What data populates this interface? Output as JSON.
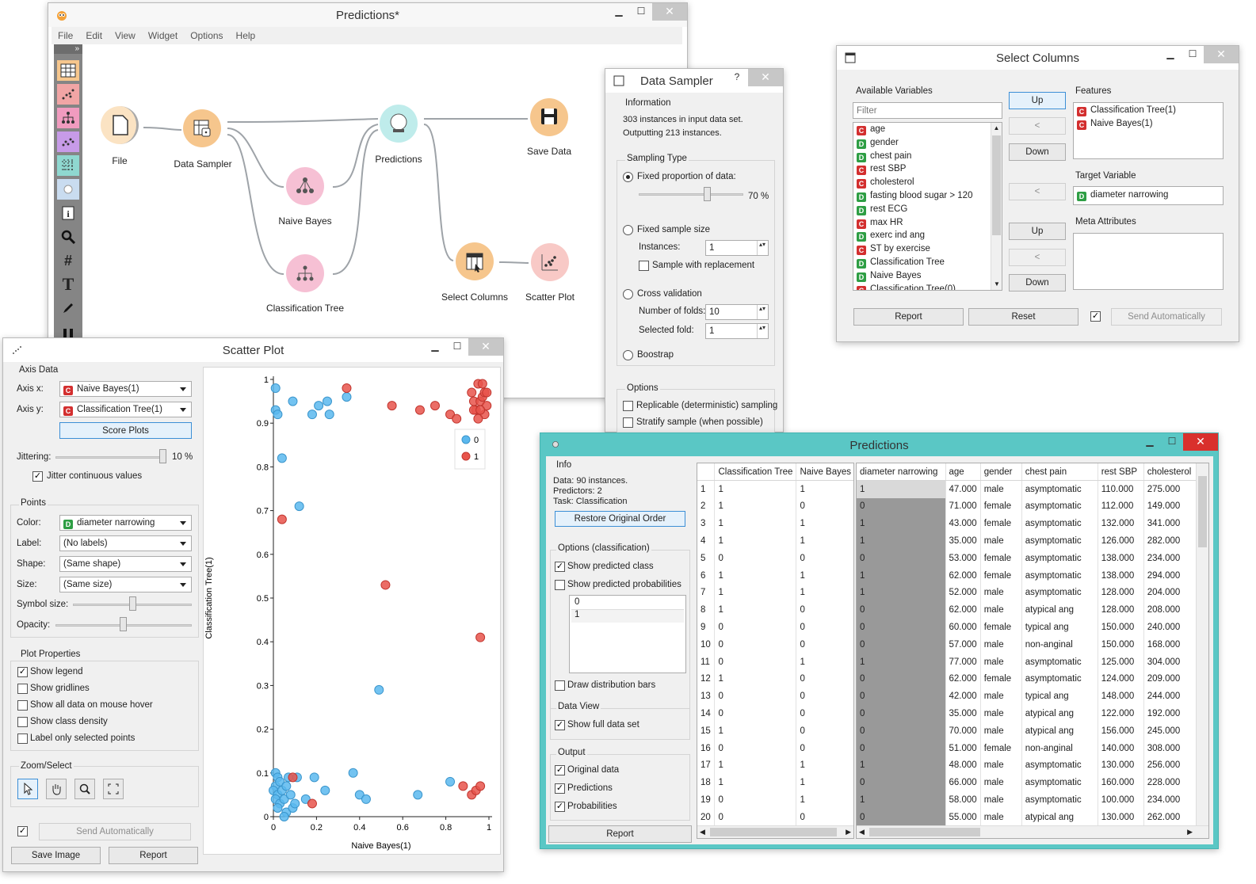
{
  "main": {
    "title": "Predictions*",
    "menu": [
      "File",
      "Edit",
      "View",
      "Widget",
      "Options",
      "Help"
    ],
    "nodes": {
      "file": "File",
      "data_sampler": "Data Sampler",
      "predictions": "Predictions",
      "save_data": "Save Data",
      "naive_bayes": "Naive Bayes",
      "classification_tree": "Classification Tree",
      "select_columns": "Select Columns",
      "scatter_plot": "Scatter Plot"
    },
    "toolbar_glyphs": {
      "more": "»",
      "hash": "#",
      "text": "T"
    }
  },
  "sampler": {
    "title": "Data Sampler",
    "help": "?",
    "information_label": "Information",
    "info1": "303 instances in input data set.",
    "info2": "Outputting 213 instances.",
    "sampling_type_label": "Sampling Type",
    "fixed_proportion": "Fixed proportion of data:",
    "proportion_pct": 70,
    "proportion_value": "70 %",
    "fixed_sample_size": "Fixed sample size",
    "instances_label": "Instances:",
    "instances_value": "1",
    "with_replacement": "Sample with replacement",
    "cross_validation": "Cross validation",
    "folds_label": "Number of folds:",
    "folds_value": "10",
    "selected_fold_label": "Selected fold:",
    "selected_fold_value": "1",
    "bootstrap": "Boostrap",
    "options_label": "Options",
    "replicable": "Replicable (deterministic) sampling",
    "stratify": "Stratify sample (when possible)"
  },
  "select_columns": {
    "title": "Select Columns",
    "available_label": "Available Variables",
    "filter_placeholder": "Filter",
    "available": [
      {
        "t": "C",
        "n": "age"
      },
      {
        "t": "D",
        "n": "gender"
      },
      {
        "t": "D",
        "n": "chest pain"
      },
      {
        "t": "C",
        "n": "rest SBP"
      },
      {
        "t": "C",
        "n": "cholesterol"
      },
      {
        "t": "D",
        "n": "fasting blood sugar > 120"
      },
      {
        "t": "D",
        "n": "rest ECG"
      },
      {
        "t": "C",
        "n": "max HR"
      },
      {
        "t": "D",
        "n": "exerc ind ang"
      },
      {
        "t": "C",
        "n": "ST by exercise"
      },
      {
        "t": "D",
        "n": "Classification Tree"
      },
      {
        "t": "D",
        "n": "Naive Bayes"
      },
      {
        "t": "C",
        "n": "Classification Tree(0)"
      }
    ],
    "up": "Up",
    "down": "Down",
    "arrow": "<",
    "features_label": "Features",
    "features": [
      {
        "t": "C",
        "n": "Classification Tree(1)"
      },
      {
        "t": "C",
        "n": "Naive Bayes(1)"
      }
    ],
    "target_label": "Target Variable",
    "target": {
      "t": "D",
      "n": "diameter narrowing"
    },
    "meta_label": "Meta Attributes",
    "report": "Report",
    "reset": "Reset",
    "send_auto": "Send Automatically",
    "check": "✓"
  },
  "scatter": {
    "title": "Scatter Plot",
    "axis_data_label": "Axis Data",
    "axis_x_label": "Axis x:",
    "axis_x": "Naive Bayes(1)",
    "axis_y_label": "Axis y:",
    "axis_y": "Classification Tree(1)",
    "score_plots": "Score Plots",
    "jittering_label": "Jittering:",
    "jittering_value": "10 %",
    "jittering_pct": 100,
    "jitter_cont": "Jitter continuous values",
    "points_label": "Points",
    "color_label": "Color:",
    "color_value": "diameter narrowing",
    "label_label": "Label:",
    "label_value": "(No labels)",
    "shape_label": "Shape:",
    "shape_value": "(Same shape)",
    "size_label": "Size:",
    "size_value": "(Same size)",
    "symbol_size_label": "Symbol size:",
    "symbol_size_pct": 50,
    "opacity_label": "Opacity:",
    "opacity_pct": 45,
    "plot_props_label": "Plot Properties",
    "show_legend": "Show legend",
    "show_gridlines": "Show gridlines",
    "show_all_data": "Show all data on mouse hover",
    "show_density": "Show class density",
    "label_selected": "Label only selected points",
    "zoom_label": "Zoom/Select",
    "send_auto": "Send Automatically",
    "save_image": "Save Image",
    "report": "Report",
    "check": "✓"
  },
  "predictions": {
    "title": "Predictions",
    "info_label": "Info",
    "info1": "Data: 90 instances.",
    "info2": "Predictors: 2",
    "info3": "Task: Classification",
    "restore": "Restore Original Order",
    "options_label": "Options (classification)",
    "show_class": "Show predicted class",
    "show_probs": "Show predicted probabilities",
    "classes": [
      "0",
      "1"
    ],
    "draw_bars": "Draw distribution bars",
    "data_view_label": "Data View",
    "show_full": "Show full data set",
    "output_label": "Output",
    "original_data": "Original data",
    "predictions_out": "Predictions",
    "probabilities": "Probabilities",
    "report": "Report",
    "check": "✓",
    "pred_headers": [
      "Classification Tree",
      "Naive Bayes"
    ],
    "data_headers": [
      "diameter narrowing",
      "age",
      "gender",
      "chest pain",
      "rest SBP",
      "cholesterol"
    ],
    "rows": [
      [
        "1",
        "1",
        "1",
        "1",
        "47.000",
        "male",
        "asymptomatic",
        "110.000",
        "275.000"
      ],
      [
        "2",
        "1",
        "0",
        "0",
        "71.000",
        "female",
        "asymptomatic",
        "112.000",
        "149.000"
      ],
      [
        "3",
        "1",
        "1",
        "1",
        "43.000",
        "female",
        "asymptomatic",
        "132.000",
        "341.000"
      ],
      [
        "4",
        "1",
        "1",
        "1",
        "35.000",
        "male",
        "asymptomatic",
        "126.000",
        "282.000"
      ],
      [
        "5",
        "0",
        "0",
        "0",
        "53.000",
        "female",
        "asymptomatic",
        "138.000",
        "234.000"
      ],
      [
        "6",
        "1",
        "1",
        "1",
        "62.000",
        "female",
        "asymptomatic",
        "138.000",
        "294.000"
      ],
      [
        "7",
        "1",
        "1",
        "1",
        "52.000",
        "male",
        "asymptomatic",
        "128.000",
        "204.000"
      ],
      [
        "8",
        "1",
        "0",
        "0",
        "62.000",
        "male",
        "atypical ang",
        "128.000",
        "208.000"
      ],
      [
        "9",
        "0",
        "0",
        "0",
        "60.000",
        "female",
        "typical ang",
        "150.000",
        "240.000"
      ],
      [
        "10",
        "0",
        "0",
        "0",
        "57.000",
        "male",
        "non-anginal",
        "150.000",
        "168.000"
      ],
      [
        "11",
        "0",
        "1",
        "1",
        "77.000",
        "male",
        "asymptomatic",
        "125.000",
        "304.000"
      ],
      [
        "12",
        "1",
        "0",
        "0",
        "62.000",
        "female",
        "asymptomatic",
        "124.000",
        "209.000"
      ],
      [
        "13",
        "0",
        "0",
        "0",
        "42.000",
        "male",
        "typical ang",
        "148.000",
        "244.000"
      ],
      [
        "14",
        "0",
        "0",
        "0",
        "35.000",
        "male",
        "atypical ang",
        "122.000",
        "192.000"
      ],
      [
        "15",
        "1",
        "0",
        "0",
        "70.000",
        "male",
        "atypical ang",
        "156.000",
        "245.000"
      ],
      [
        "16",
        "0",
        "0",
        "0",
        "51.000",
        "female",
        "non-anginal",
        "140.000",
        "308.000"
      ],
      [
        "17",
        "1",
        "1",
        "1",
        "48.000",
        "male",
        "asymptomatic",
        "130.000",
        "256.000"
      ],
      [
        "18",
        "1",
        "1",
        "0",
        "66.000",
        "male",
        "asymptomatic",
        "160.000",
        "228.000"
      ],
      [
        "19",
        "0",
        "1",
        "1",
        "58.000",
        "male",
        "asymptomatic",
        "100.000",
        "234.000"
      ],
      [
        "20",
        "0",
        "0",
        "0",
        "55.000",
        "male",
        "atypical ang",
        "130.000",
        "262.000"
      ]
    ]
  },
  "chart_data": {
    "type": "scatter",
    "xlabel": "Naive Bayes(1)",
    "ylabel": "Classification Tree(1)",
    "xlim": [
      0,
      1
    ],
    "ylim": [
      0,
      1
    ],
    "xticks": [
      "0",
      "0.2",
      "0.4",
      "0.6",
      "0.8",
      "1"
    ],
    "yticks": [
      "0",
      "0.1",
      "0.2",
      "0.3",
      "0.4",
      "0.5",
      "0.6",
      "0.7",
      "0.8",
      "0.9",
      "1"
    ],
    "legend": [
      "0",
      "1"
    ],
    "legend_position": "top-right",
    "grid": false,
    "colors": {
      "0": "#5bb8ee",
      "1": "#e8544b"
    },
    "series": [
      {
        "name": "0",
        "points": [
          [
            0.01,
            0.98
          ],
          [
            0.01,
            0.93
          ],
          [
            0.02,
            0.92
          ],
          [
            0.04,
            0.82
          ],
          [
            0.09,
            0.95
          ],
          [
            0.18,
            0.92
          ],
          [
            0.21,
            0.94
          ],
          [
            0.25,
            0.95
          ],
          [
            0.26,
            0.92
          ],
          [
            0.34,
            0.96
          ],
          [
            0.12,
            0.71
          ],
          [
            0.49,
            0.29
          ],
          [
            0.01,
            0.1
          ],
          [
            0.02,
            0.09
          ],
          [
            0.01,
            0.07
          ],
          [
            0.03,
            0.08
          ],
          [
            0.0,
            0.06
          ],
          [
            0.02,
            0.05
          ],
          [
            0.04,
            0.06
          ],
          [
            0.06,
            0.07
          ],
          [
            0.01,
            0.04
          ],
          [
            0.03,
            0.03
          ],
          [
            0.05,
            0.04
          ],
          [
            0.08,
            0.05
          ],
          [
            0.02,
            0.02
          ],
          [
            0.06,
            0.01
          ],
          [
            0.09,
            0.02
          ],
          [
            0.1,
            0.03
          ],
          [
            0.05,
            0.0
          ],
          [
            0.15,
            0.04
          ],
          [
            0.19,
            0.09
          ],
          [
            0.24,
            0.06
          ],
          [
            0.37,
            0.1
          ],
          [
            0.4,
            0.05
          ],
          [
            0.43,
            0.04
          ],
          [
            0.67,
            0.05
          ],
          [
            0.82,
            0.08
          ],
          [
            0.07,
            0.09
          ],
          [
            0.11,
            0.09
          ]
        ]
      },
      {
        "name": "1",
        "points": [
          [
            0.34,
            0.98
          ],
          [
            0.55,
            0.94
          ],
          [
            0.68,
            0.93
          ],
          [
            0.75,
            0.94
          ],
          [
            0.82,
            0.92
          ],
          [
            0.85,
            0.91
          ],
          [
            0.92,
            0.97
          ],
          [
            0.93,
            0.95
          ],
          [
            0.94,
            0.93
          ],
          [
            0.95,
            0.99
          ],
          [
            0.96,
            0.95
          ],
          [
            0.97,
            0.96
          ],
          [
            0.98,
            0.92
          ],
          [
            0.99,
            0.94
          ],
          [
            0.95,
            0.91
          ],
          [
            0.97,
            0.99
          ],
          [
            0.98,
            0.97
          ],
          [
            0.93,
            0.93
          ],
          [
            0.99,
            0.97
          ],
          [
            0.96,
            0.93
          ],
          [
            0.04,
            0.68
          ],
          [
            0.52,
            0.53
          ],
          [
            0.96,
            0.41
          ],
          [
            0.09,
            0.09
          ],
          [
            0.18,
            0.03
          ],
          [
            0.92,
            0.05
          ],
          [
            0.94,
            0.06
          ],
          [
            0.96,
            0.07
          ],
          [
            0.88,
            0.07
          ]
        ]
      }
    ]
  }
}
